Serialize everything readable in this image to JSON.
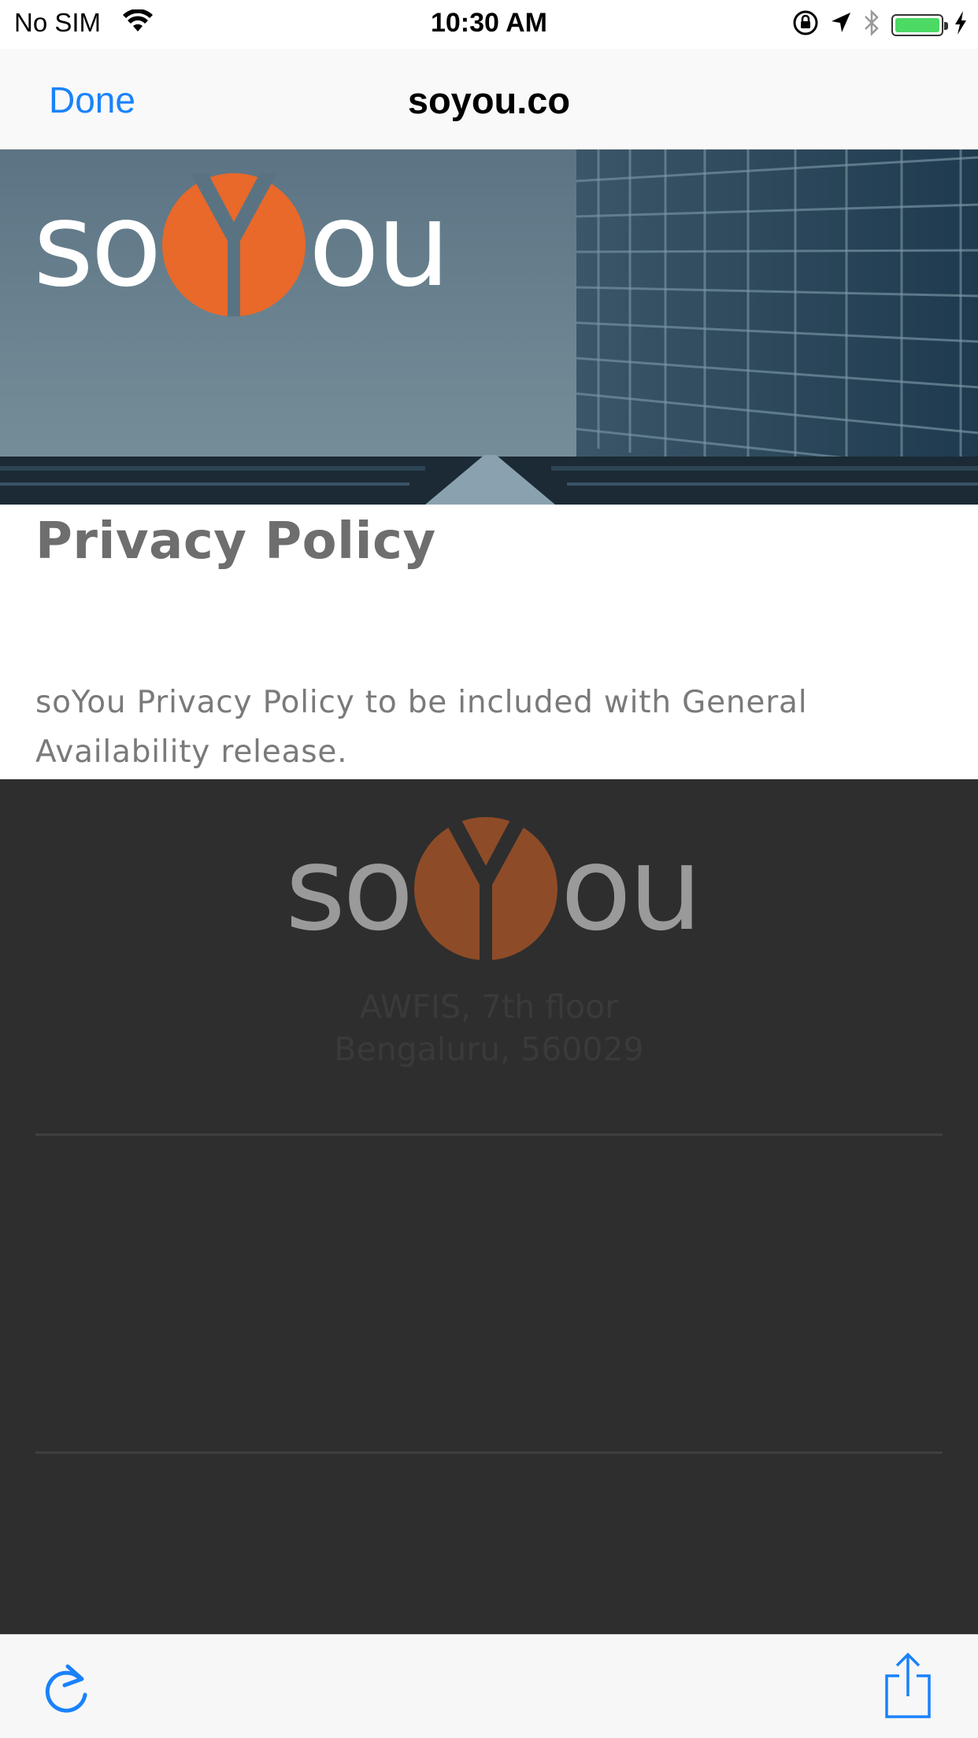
{
  "status_bar": {
    "carrier": "No SIM",
    "time": "10:30 AM",
    "battery_level": 1.0,
    "icons": [
      "wifi-icon",
      "orientation-lock-icon",
      "location-arrow-icon",
      "bluetooth-icon",
      "battery-icon",
      "charging-bolt-icon"
    ]
  },
  "nav": {
    "done_label": "Done",
    "title": "soyou.co"
  },
  "hero": {
    "logo_left": "so",
    "logo_right": "ou",
    "logo_accent_color": "#e8692a"
  },
  "content": {
    "heading": "Privacy Policy",
    "body": "soYou Privacy Policy to be included with General Availability release."
  },
  "footer": {
    "logo_left": "so",
    "logo_right": "ou",
    "address_line1": "AWFIS, 7th floor",
    "address_line2": "Bengaluru, 560029"
  },
  "toolbar": {
    "icons": [
      "reload-icon",
      "share-icon"
    ],
    "accent_color": "#1a82fb"
  }
}
